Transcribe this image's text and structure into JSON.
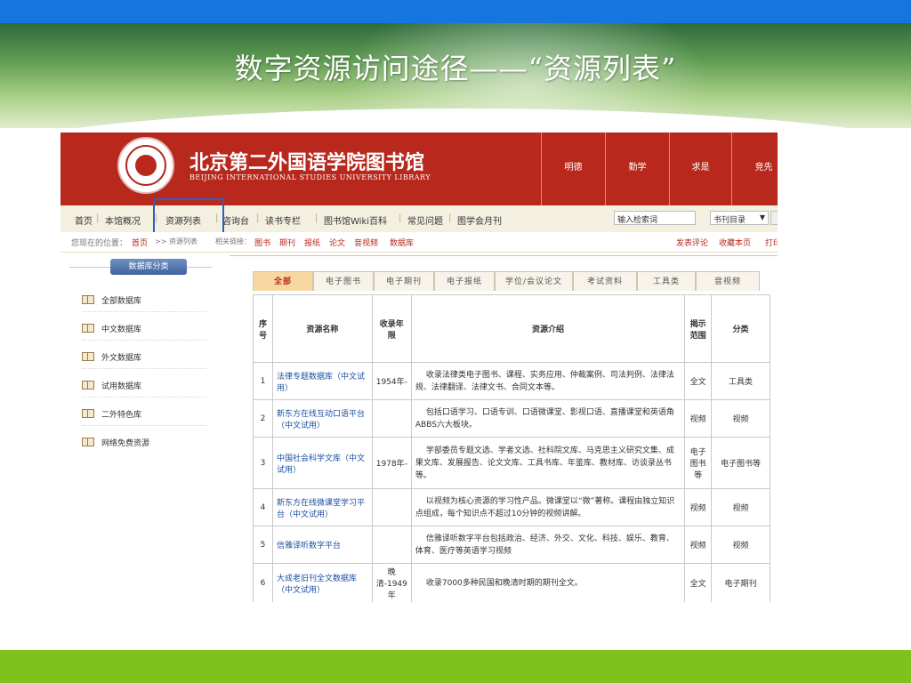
{
  "slide": {
    "title": "数字资源访问途径——“资源列表”"
  },
  "library": {
    "name_cn": "北京第二外国语学院图书馆",
    "name_en": "BEIJING INTERNATIONAL STUDIES UNIVERSITY LIBRARY",
    "mottos": [
      "明德",
      "勤学",
      "求是",
      "竞先"
    ]
  },
  "nav": {
    "items": [
      "首页",
      "本馆概况",
      "资源列表",
      "咨询台",
      "读书专栏",
      "图书馆Wiki百科",
      "常见问题",
      "图学会月刊"
    ],
    "search_placeholder": "输入检索词",
    "catalog_select": "书刊目录",
    "highlighted_item": "资源列表"
  },
  "breadcrumb": {
    "location_label": "您现在的位置：",
    "home": "首页",
    "current": ">> 资源列表",
    "related_label": "相关链接：",
    "related_links": [
      "图书",
      "期刊",
      "报纸",
      "论文",
      "音视频",
      "数据库"
    ],
    "actions": [
      "发表评论",
      "收藏本页",
      "打印"
    ]
  },
  "sidebar": {
    "title": "数据库分类",
    "items": [
      "全部数据库",
      "中文数据库",
      "外文数据库",
      "试用数据库",
      "二外特色库",
      "网络免费资源"
    ]
  },
  "tabs": [
    "全部",
    "电子图书",
    "电子期刊",
    "电子报纸",
    "学位/会议论文",
    "考试资料",
    "工具类",
    "音视频"
  ],
  "table": {
    "headers": [
      "序号",
      "资源名称",
      "收录年限",
      "资源介绍",
      "揭示范围",
      "分类"
    ],
    "rows": [
      {
        "no": "1",
        "name": "法律专题数据库（中文试用）",
        "years": "1954年-",
        "intro": "收录法律类电子图书、课程、实务应用、仲裁案例、司法判例、法律法规、法律翻译、法律文书、合同文本等。",
        "scope": "全文",
        "category": "工具类"
      },
      {
        "no": "2",
        "name": "新东方在线互动口语平台（中文试用）",
        "years": "",
        "intro": "包括口语学习、口语专训、口语微课堂、影视口语、直播课堂和英语角ABBS六大板块。",
        "scope": "视频",
        "category": "视频"
      },
      {
        "no": "3",
        "name": "中国社会科学文库（中文试用）",
        "years": "1978年-",
        "intro": "学部委员专题文选、学者文选、社科院文库、马克思主义研究文集、成果文库、发展报告、论文文库、工具书库、年鉴库、教材库、访谈录丛书等。",
        "scope": "电子图书等",
        "category": "电子图书等"
      },
      {
        "no": "4",
        "name": "新东方在线微课堂学习平台（中文试用）",
        "years": "",
        "intro": "以视频为核心资源的学习性产品。微课堂以“微”著称。课程由独立知识点组成，每个知识点不超过10分钟的视频讲解。",
        "scope": "视频",
        "category": "视频"
      },
      {
        "no": "5",
        "name": "信雅译听数字平台",
        "years": "",
        "intro": "信雅译听数字平台包括政治、经济、外交、文化、科技、娱乐、教育、体育、医疗等英语学习视频",
        "scope": "视频",
        "category": "视频"
      },
      {
        "no": "6",
        "name": "大成老旧刊全文数据库（中文试用）",
        "years": "晚清-1949年",
        "intro": "收录7000多种民国和晚清时期的期刊全文。",
        "scope": "全文",
        "category": "电子期刊"
      }
    ]
  },
  "colors": {
    "header_red": "#b8281c",
    "top_bar_blue": "#1676e0",
    "bottom_bar_green": "#7ec21b",
    "highlight_box": "#2a5fc2",
    "link_blue": "#1c4fa0"
  }
}
